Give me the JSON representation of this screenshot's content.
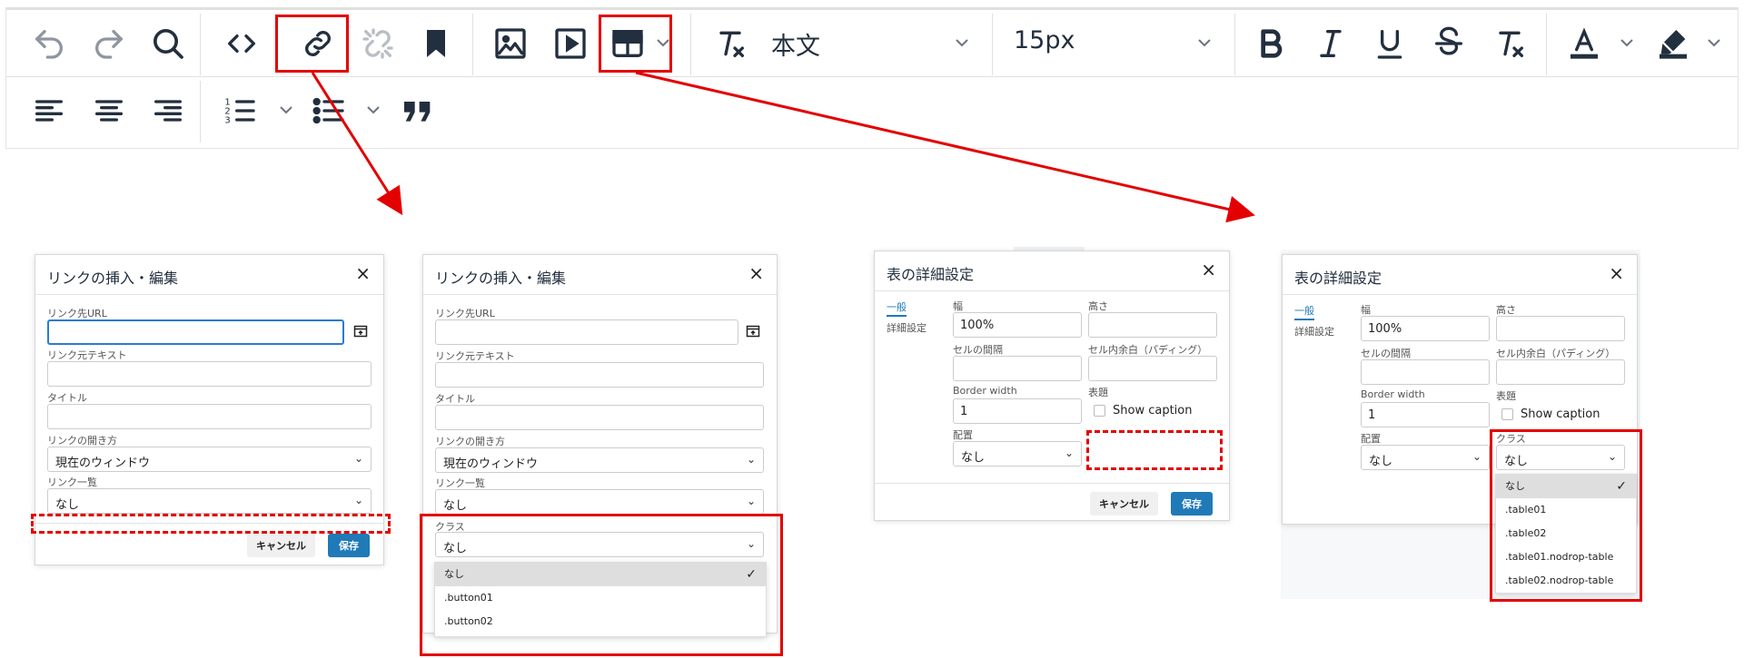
{
  "toolbar": {
    "block_format": "本文",
    "font_size": "15px",
    "icons_row1": [
      "undo-icon",
      "redo-icon",
      "search-icon",
      "code-icon",
      "link-icon",
      "unlink-icon",
      "bookmark-icon",
      "image-icon",
      "media-icon",
      "table-icon",
      "clear-format-icon",
      "bold-icon",
      "italic-icon",
      "underline-icon",
      "strikethrough-icon",
      "remove-format-icon",
      "font-color-icon",
      "highlight-icon"
    ],
    "icons_row2": [
      "align-left-icon",
      "align-center-icon",
      "align-right-icon",
      "numbered-list-icon",
      "bullet-list-icon",
      "blockquote-icon"
    ]
  },
  "link_dialog_1": {
    "title": "リンクの挿入・編集",
    "url_label": "リンク先URL",
    "text_label": "リンク元テキスト",
    "title_label": "タイトル",
    "target_label": "リンクの開き方",
    "target_value": "現在のウィンドウ",
    "list_label": "リンク一覧",
    "list_value": "なし",
    "cancel": "キャンセル",
    "save": "保存"
  },
  "link_dialog_2": {
    "title": "リンクの挿入・編集",
    "url_label": "リンク先URL",
    "text_label": "リンク元テキスト",
    "title_label": "タイトル",
    "target_label": "リンクの開き方",
    "target_value": "現在のウィンドウ",
    "list_label": "リンク一覧",
    "list_value": "なし",
    "class_label": "クラス",
    "class_value": "なし",
    "class_options": [
      "なし",
      ".button01",
      ".button02"
    ]
  },
  "table_dialog_1": {
    "title": "表の詳細設定",
    "tab_general": "一般",
    "tab_advanced": "詳細設定",
    "width_label": "幅",
    "width_value": "100%",
    "height_label": "高さ",
    "spacing_label": "セルの間隔",
    "padding_label": "セル内余白（パディング）",
    "border_label": "Border width",
    "border_value": "1",
    "caption_label": "表題",
    "show_caption": "Show caption",
    "align_label": "配置",
    "align_value": "なし",
    "cancel": "キャンセル",
    "save": "保存"
  },
  "table_dialog_2": {
    "title": "表の詳細設定",
    "tab_general": "一般",
    "tab_advanced": "詳細設定",
    "width_label": "幅",
    "width_value": "100%",
    "height_label": "高さ",
    "spacing_label": "セルの間隔",
    "padding_label": "セル内余白（パディング）",
    "border_label": "Border width",
    "border_value": "1",
    "caption_label": "表題",
    "show_caption": "Show caption",
    "align_label": "配置",
    "align_value": "なし",
    "class_label": "クラス",
    "class_value": "なし",
    "class_options": [
      "なし",
      ".table01",
      ".table02",
      ".table01.nodrop-table",
      ".table02.nodrop-table"
    ]
  },
  "colors": {
    "highlight": "#e30000",
    "save": "#207ab7",
    "focus": "#2b7bd2"
  }
}
